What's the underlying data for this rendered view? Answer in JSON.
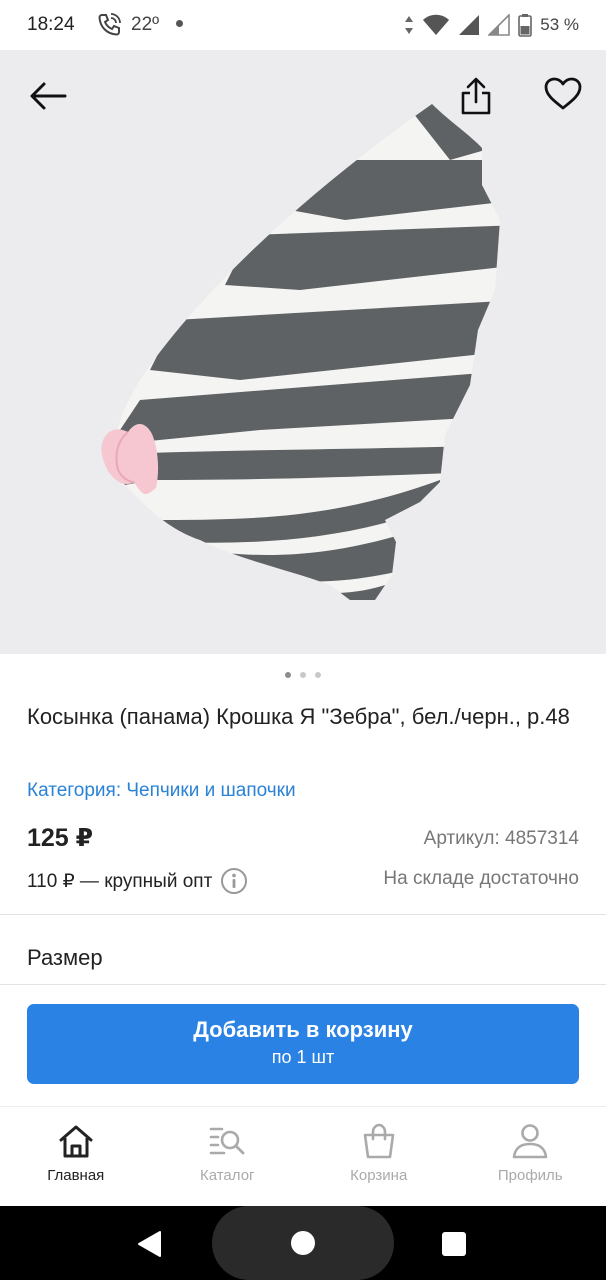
{
  "status_bar": {
    "time": "18:24",
    "temperature": "22º",
    "battery": "53 %"
  },
  "header": {
    "back_icon": "arrow-left-icon",
    "share_icon": "share-icon",
    "favorite_icon": "heart-outline-icon"
  },
  "gallery": {
    "image": "product-photo-zebra-kerchief",
    "page_count": 3,
    "active_page": 1
  },
  "product": {
    "title": "Косынка (панама) Крошка Я \"Зебра\", бел./черн., р.48",
    "category": "Категория: Чепчики и шапочки",
    "price": "125 ₽",
    "sku": "Артикул: 4857314",
    "wholesale": "110 ₽ — крупный опт",
    "stock": "На складе достаточно"
  },
  "size_section": {
    "label": "Размер"
  },
  "cart_button": {
    "label": "Добавить в корзину",
    "sublabel": "по 1 шт"
  },
  "bottom_nav": {
    "tabs": [
      {
        "label": "Главная",
        "icon": "home-icon",
        "active": true
      },
      {
        "label": "Каталог",
        "icon": "catalog-search-icon",
        "active": false
      },
      {
        "label": "Корзина",
        "icon": "shopping-bag-icon",
        "active": false
      },
      {
        "label": "Профиль",
        "icon": "profile-icon",
        "active": false
      }
    ]
  },
  "colors": {
    "accent": "#2a82e4",
    "link": "#2a82d6",
    "inactive": "#aaaaaa"
  }
}
